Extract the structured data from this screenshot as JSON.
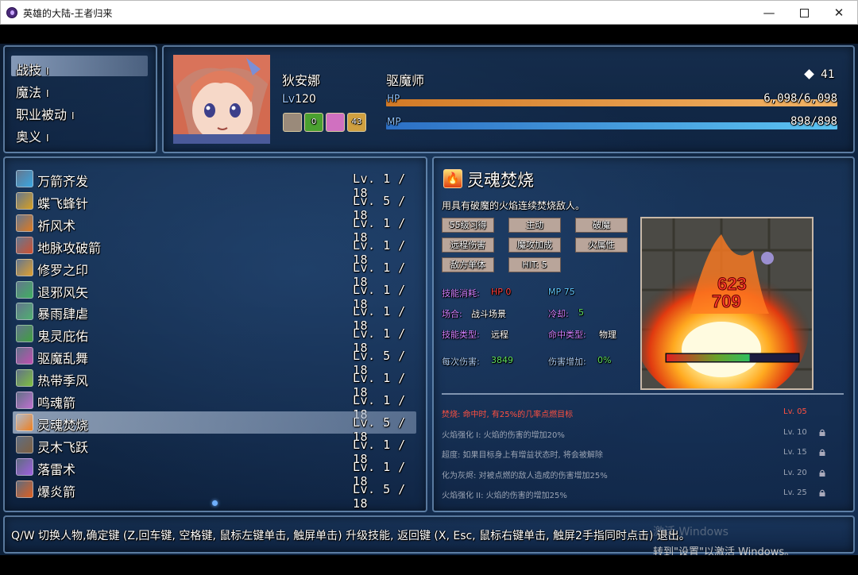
{
  "window": {
    "title": "英雄的大陆-王者归来",
    "minimize": "—",
    "maximize": "",
    "close": "✕"
  },
  "categories": [
    {
      "label": "战技",
      "mark": "I"
    },
    {
      "label": "魔法",
      "mark": "I"
    },
    {
      "label": "职业被动",
      "mark": "I"
    },
    {
      "label": "奥义",
      "mark": "I"
    }
  ],
  "actor": {
    "name": "狄安娜",
    "class": "驱魔师",
    "level_prefix": "Lv",
    "level": "120",
    "gem_icon": "diamond-icon",
    "gems": "41",
    "hp_label": "HP",
    "hp_value": "6,098/6,098",
    "hp_fraction": 1.0,
    "mp_label": "MP",
    "mp_value": "898/898",
    "mp_fraction": 1.0,
    "states": [
      {
        "icon": "armor-state-icon",
        "count": ""
      },
      {
        "icon": "arrow-buff-icon",
        "count": "0"
      },
      {
        "icon": "skull-debuff-icon",
        "count": ""
      },
      {
        "icon": "coin-state-icon",
        "count": "43"
      }
    ]
  },
  "skills": [
    {
      "name": "万箭齐发",
      "level": "Lv. 1 / 18",
      "icon": "arrow-rain-icon",
      "color": "#3aa6e0"
    },
    {
      "name": "蝶飞蜂针",
      "level": "Lv. 5 / 18",
      "icon": "bee-sting-icon",
      "color": "#d9a020"
    },
    {
      "name": "祈风术",
      "level": "Lv. 1 / 18",
      "icon": "wind-prayer-icon",
      "color": "#e07a20"
    },
    {
      "name": "地脉攻破箭",
      "level": "Lv. 1 / 18",
      "icon": "earth-arrow-icon",
      "color": "#d05030"
    },
    {
      "name": "修罗之印",
      "level": "Lv. 1 / 18",
      "icon": "asura-seal-icon",
      "color": "#e0a030"
    },
    {
      "name": "退邪风矢",
      "level": "Lv. 1 / 18",
      "icon": "wind-arrow-icon",
      "color": "#40b060"
    },
    {
      "name": "暴雨肆虐",
      "level": "Lv. 1 / 18",
      "icon": "storm-icon",
      "color": "#50b070"
    },
    {
      "name": "鬼灵庇佑",
      "level": "Lv. 1 / 18",
      "icon": "spirit-shield-icon",
      "color": "#40a040"
    },
    {
      "name": "驱魔乱舞",
      "level": "Lv. 5 / 18",
      "icon": "exorcism-dance-icon",
      "color": "#c050b0"
    },
    {
      "name": "热带季风",
      "level": "Lv. 1 / 18",
      "icon": "monsoon-icon",
      "color": "#80c040"
    },
    {
      "name": "鸣魂箭",
      "level": "Lv. 1 / 18",
      "icon": "soul-arrow-icon",
      "color": "#c070d0"
    },
    {
      "name": "灵魂焚烧",
      "level": "Lv. 5 / 18",
      "icon": "soul-burn-icon",
      "color": "#f08020"
    },
    {
      "name": "灵木飞跃",
      "level": "Lv. 1 / 18",
      "icon": "spirit-wood-icon",
      "color": "#806040"
    },
    {
      "name": "落雷术",
      "level": "Lv. 1 / 18",
      "icon": "thunder-icon",
      "color": "#a060e0"
    },
    {
      "name": "爆炎箭",
      "level": "Lv. 5 / 18",
      "icon": "blaze-arrow-icon",
      "color": "#e06020"
    }
  ],
  "selected_index": 11,
  "detail": {
    "title": "灵魂焚烧",
    "description": "用具有破魔的火焰连续焚烧敌人。",
    "tags": [
      "55级习得",
      "主动",
      "破魔",
      "远程伤害",
      "魔攻加成",
      "火属性",
      "敌方单体",
      "HIT: 5"
    ],
    "cost_label": "技能消耗:",
    "cost_hp": "HP 0",
    "cost_mp": "MP 75",
    "occasion_label": "场合:",
    "occasion_value": "战斗场景",
    "cooldown_label": "冷却:",
    "cooldown_value": "5",
    "type_label": "技能类型:",
    "type_value": "远程",
    "hit_label": "命中类型:",
    "hit_value": "物理",
    "damage_label": "每次伤害:",
    "damage_value": "3849",
    "increase_label": "伤害增加:",
    "increase_value": "0%",
    "preview_numbers": [
      "623",
      "709"
    ],
    "preview_enemy_hp_fraction": 0.63,
    "passives": [
      {
        "text": "焚烧: 命中时, 有25%的几率点燃目标",
        "level": "Lv. 05",
        "locked": false,
        "active": true
      },
      {
        "text": "火焰强化 I: 火焰的伤害的增加20%",
        "level": "Lv. 10",
        "locked": true,
        "active": false
      },
      {
        "text": "超度: 如果目标身上有增益状态时, 将会被解除",
        "level": "Lv. 15",
        "locked": true,
        "active": false
      },
      {
        "text": "化为灰烬: 对被点燃的敌人造成的伤害增加25%",
        "level": "Lv. 20",
        "locked": true,
        "active": false
      },
      {
        "text": "火焰强化 II: 火焰的伤害的增加25%",
        "level": "Lv. 25",
        "locked": true,
        "active": false
      }
    ]
  },
  "help_text": "Q/W 切换人物,确定键 (Z,回车键, 空格键, 鼠标左键单击, 触屏单击) 升级技能, 返回键 (X, Esc, 鼠标右键单击, 触屏2手指同时点击) 退出。",
  "os_overlay": {
    "watermark": "激活 Windows",
    "hint": "转到\"设置\"以激活 Windows。"
  },
  "colors": {
    "hp_bar": "#e89a3c",
    "mp_bar": "#46a8e8",
    "accent_red": "#ff4040",
    "accent_green": "#60e060",
    "accent_purple": "#d080ff",
    "accent_cyan": "#60d0ff"
  }
}
